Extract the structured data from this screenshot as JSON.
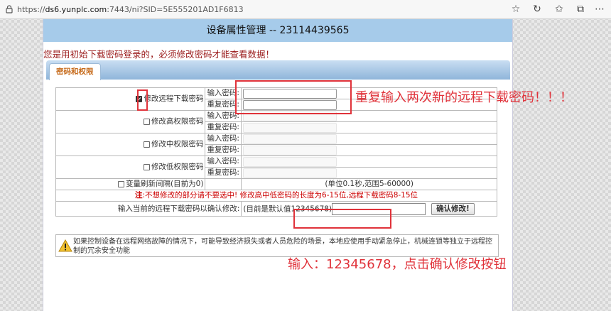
{
  "browser": {
    "url_prefix": "https://",
    "url_host": "ds6.yunplc.com",
    "url_rest": ":7443/ni?SID=5E555201AD1F6813"
  },
  "page": {
    "title": "设备属性管理 -- 23114439565",
    "warning": "您是用初始下载密码登录的，必须修改密码才能查看数据！",
    "tab_label": "密码和权限"
  },
  "form": {
    "groups": [
      {
        "label": "修改远程下载密码",
        "checked": true,
        "fields": [
          {
            "label": "输入密码:"
          },
          {
            "label": "重复密码:"
          }
        ]
      },
      {
        "label": "修改高权限密码",
        "checked": false,
        "fields": [
          {
            "label": "输入密码:"
          },
          {
            "label": "重复密码:"
          }
        ]
      },
      {
        "label": "修改中权限密码",
        "checked": false,
        "fields": [
          {
            "label": "输入密码:"
          },
          {
            "label": "重复密码:"
          }
        ]
      },
      {
        "label": "修改低权限密码",
        "checked": false,
        "fields": [
          {
            "label": "输入密码:"
          },
          {
            "label": "重复密码:"
          }
        ]
      }
    ],
    "refresh_label": "变量刷新间隔(目前为0)",
    "refresh_range": "(单位0.1秒,范围5-60000)",
    "note_prefix": "注",
    "note_text": ":不想修改的部分请不要选中! 修改高中低密码的长度为6-15位,远程下载密码8-15位",
    "confirm_label": "输入当前的远程下载密码以确认修改:",
    "confirm_hint": "(目前是默认值12345678)",
    "confirm_button": "确认修改!"
  },
  "safety_notice": "如果控制设备在远程网络故障的情况下，可能导致经济损失或者人员危险的场景，本地应使用手动紧急停止，机械连锁等独立于远程控制的冗余安全功能",
  "annotations": {
    "top": "重复输入两次新的远程下载密码！！！",
    "bottom": "输入：12345678，点击确认修改按钮",
    "color": "#e0323a"
  },
  "colors": {
    "title_bar": "#a6cbea",
    "warning_text": "#9b1c1c",
    "tab_text": "#c66a1a",
    "note_text": "#cc0000"
  },
  "icons": [
    "lock-icon",
    "star-icon",
    "refresh-icon",
    "favorites-icon",
    "collections-icon",
    "warning-icon"
  ]
}
